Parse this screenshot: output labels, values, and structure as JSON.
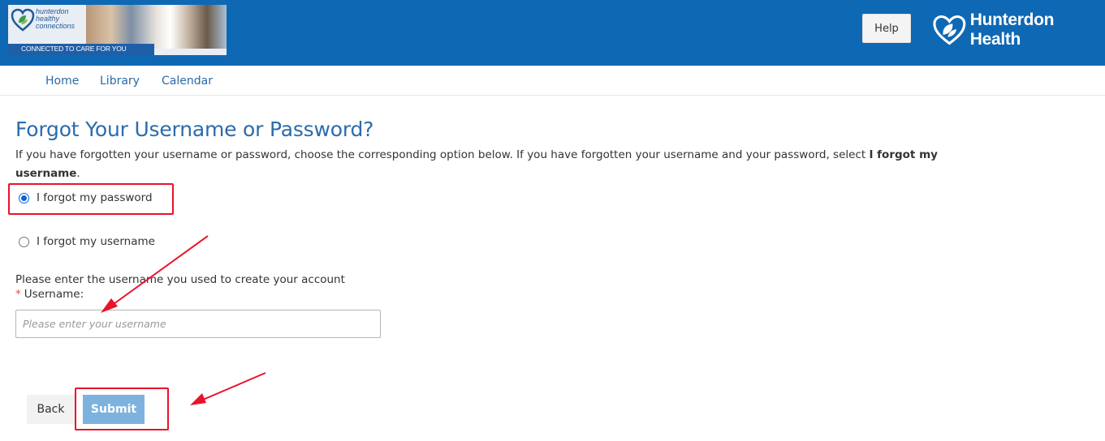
{
  "header": {
    "banner": {
      "logo_text": "hunterdon healthy connections",
      "tagline": "CONNECTED TO CARE FOR YOU"
    },
    "help_label": "Help",
    "brand_name": "Hunterdon Health"
  },
  "nav": {
    "items": [
      {
        "label": "Home"
      },
      {
        "label": "Library"
      },
      {
        "label": "Calendar"
      }
    ]
  },
  "form": {
    "title": "Forgot Your Username or Password?",
    "intro_text": "If you have forgotten your username or password, choose the corresponding option below. If you have forgotten your username and your password, select ",
    "intro_bold": "I forgot my username",
    "intro_end": ".",
    "options": [
      {
        "label": "I forgot my password",
        "selected": true
      },
      {
        "label": "I forgot my username",
        "selected": false
      }
    ],
    "prompt": "Please enter the username you used to create your account",
    "required_mark": "*",
    "username_label": "Username:",
    "username_value": "",
    "username_placeholder": "Please enter your username",
    "back_label": "Back",
    "submit_label": "Submit"
  },
  "colors": {
    "header_bg": "#0f68b4",
    "link": "#2a6aa8",
    "title": "#2b6cab",
    "submit_bg": "#7eb2de",
    "annotation": "#e8132a"
  }
}
